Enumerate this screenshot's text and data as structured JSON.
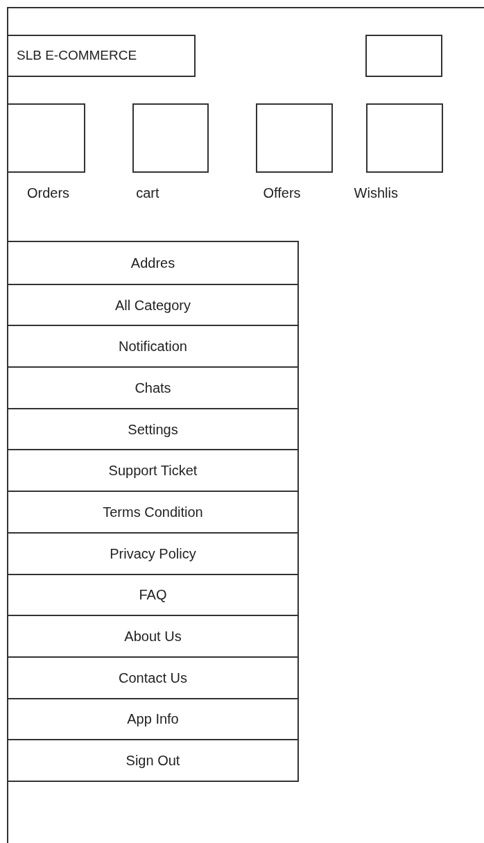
{
  "header": {
    "title": "SLB E-COMMERCE"
  },
  "tiles": [
    {
      "label": "Orders"
    },
    {
      "label": "cart"
    },
    {
      "label": "Offers"
    },
    {
      "label": "Wishlis"
    }
  ],
  "menu": [
    {
      "label": "Addres"
    },
    {
      "label": "All Category"
    },
    {
      "label": "Notification"
    },
    {
      "label": "Chats"
    },
    {
      "label": "Settings"
    },
    {
      "label": "Support Ticket"
    },
    {
      "label": "Terms Condition"
    },
    {
      "label": "Privacy Policy"
    },
    {
      "label": "FAQ"
    },
    {
      "label": "About Us"
    },
    {
      "label": "Contact Us"
    },
    {
      "label": "App Info"
    },
    {
      "label": "Sign Out"
    }
  ]
}
